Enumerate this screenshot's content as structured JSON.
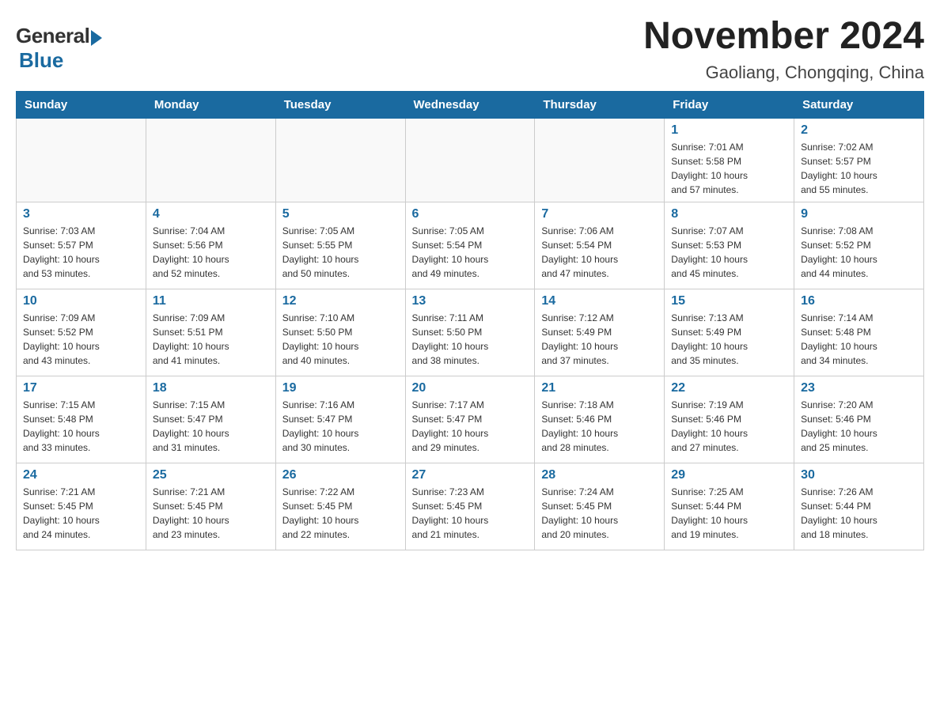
{
  "logo": {
    "general": "General",
    "blue": "Blue"
  },
  "title": "November 2024",
  "location": "Gaoliang, Chongqing, China",
  "days_of_week": [
    "Sunday",
    "Monday",
    "Tuesday",
    "Wednesday",
    "Thursday",
    "Friday",
    "Saturday"
  ],
  "weeks": [
    {
      "days": [
        {
          "num": "",
          "info": ""
        },
        {
          "num": "",
          "info": ""
        },
        {
          "num": "",
          "info": ""
        },
        {
          "num": "",
          "info": ""
        },
        {
          "num": "",
          "info": ""
        },
        {
          "num": "1",
          "info": "Sunrise: 7:01 AM\nSunset: 5:58 PM\nDaylight: 10 hours\nand 57 minutes."
        },
        {
          "num": "2",
          "info": "Sunrise: 7:02 AM\nSunset: 5:57 PM\nDaylight: 10 hours\nand 55 minutes."
        }
      ]
    },
    {
      "days": [
        {
          "num": "3",
          "info": "Sunrise: 7:03 AM\nSunset: 5:57 PM\nDaylight: 10 hours\nand 53 minutes."
        },
        {
          "num": "4",
          "info": "Sunrise: 7:04 AM\nSunset: 5:56 PM\nDaylight: 10 hours\nand 52 minutes."
        },
        {
          "num": "5",
          "info": "Sunrise: 7:05 AM\nSunset: 5:55 PM\nDaylight: 10 hours\nand 50 minutes."
        },
        {
          "num": "6",
          "info": "Sunrise: 7:05 AM\nSunset: 5:54 PM\nDaylight: 10 hours\nand 49 minutes."
        },
        {
          "num": "7",
          "info": "Sunrise: 7:06 AM\nSunset: 5:54 PM\nDaylight: 10 hours\nand 47 minutes."
        },
        {
          "num": "8",
          "info": "Sunrise: 7:07 AM\nSunset: 5:53 PM\nDaylight: 10 hours\nand 45 minutes."
        },
        {
          "num": "9",
          "info": "Sunrise: 7:08 AM\nSunset: 5:52 PM\nDaylight: 10 hours\nand 44 minutes."
        }
      ]
    },
    {
      "days": [
        {
          "num": "10",
          "info": "Sunrise: 7:09 AM\nSunset: 5:52 PM\nDaylight: 10 hours\nand 43 minutes."
        },
        {
          "num": "11",
          "info": "Sunrise: 7:09 AM\nSunset: 5:51 PM\nDaylight: 10 hours\nand 41 minutes."
        },
        {
          "num": "12",
          "info": "Sunrise: 7:10 AM\nSunset: 5:50 PM\nDaylight: 10 hours\nand 40 minutes."
        },
        {
          "num": "13",
          "info": "Sunrise: 7:11 AM\nSunset: 5:50 PM\nDaylight: 10 hours\nand 38 minutes."
        },
        {
          "num": "14",
          "info": "Sunrise: 7:12 AM\nSunset: 5:49 PM\nDaylight: 10 hours\nand 37 minutes."
        },
        {
          "num": "15",
          "info": "Sunrise: 7:13 AM\nSunset: 5:49 PM\nDaylight: 10 hours\nand 35 minutes."
        },
        {
          "num": "16",
          "info": "Sunrise: 7:14 AM\nSunset: 5:48 PM\nDaylight: 10 hours\nand 34 minutes."
        }
      ]
    },
    {
      "days": [
        {
          "num": "17",
          "info": "Sunrise: 7:15 AM\nSunset: 5:48 PM\nDaylight: 10 hours\nand 33 minutes."
        },
        {
          "num": "18",
          "info": "Sunrise: 7:15 AM\nSunset: 5:47 PM\nDaylight: 10 hours\nand 31 minutes."
        },
        {
          "num": "19",
          "info": "Sunrise: 7:16 AM\nSunset: 5:47 PM\nDaylight: 10 hours\nand 30 minutes."
        },
        {
          "num": "20",
          "info": "Sunrise: 7:17 AM\nSunset: 5:47 PM\nDaylight: 10 hours\nand 29 minutes."
        },
        {
          "num": "21",
          "info": "Sunrise: 7:18 AM\nSunset: 5:46 PM\nDaylight: 10 hours\nand 28 minutes."
        },
        {
          "num": "22",
          "info": "Sunrise: 7:19 AM\nSunset: 5:46 PM\nDaylight: 10 hours\nand 27 minutes."
        },
        {
          "num": "23",
          "info": "Sunrise: 7:20 AM\nSunset: 5:46 PM\nDaylight: 10 hours\nand 25 minutes."
        }
      ]
    },
    {
      "days": [
        {
          "num": "24",
          "info": "Sunrise: 7:21 AM\nSunset: 5:45 PM\nDaylight: 10 hours\nand 24 minutes."
        },
        {
          "num": "25",
          "info": "Sunrise: 7:21 AM\nSunset: 5:45 PM\nDaylight: 10 hours\nand 23 minutes."
        },
        {
          "num": "26",
          "info": "Sunrise: 7:22 AM\nSunset: 5:45 PM\nDaylight: 10 hours\nand 22 minutes."
        },
        {
          "num": "27",
          "info": "Sunrise: 7:23 AM\nSunset: 5:45 PM\nDaylight: 10 hours\nand 21 minutes."
        },
        {
          "num": "28",
          "info": "Sunrise: 7:24 AM\nSunset: 5:45 PM\nDaylight: 10 hours\nand 20 minutes."
        },
        {
          "num": "29",
          "info": "Sunrise: 7:25 AM\nSunset: 5:44 PM\nDaylight: 10 hours\nand 19 minutes."
        },
        {
          "num": "30",
          "info": "Sunrise: 7:26 AM\nSunset: 5:44 PM\nDaylight: 10 hours\nand 18 minutes."
        }
      ]
    }
  ]
}
